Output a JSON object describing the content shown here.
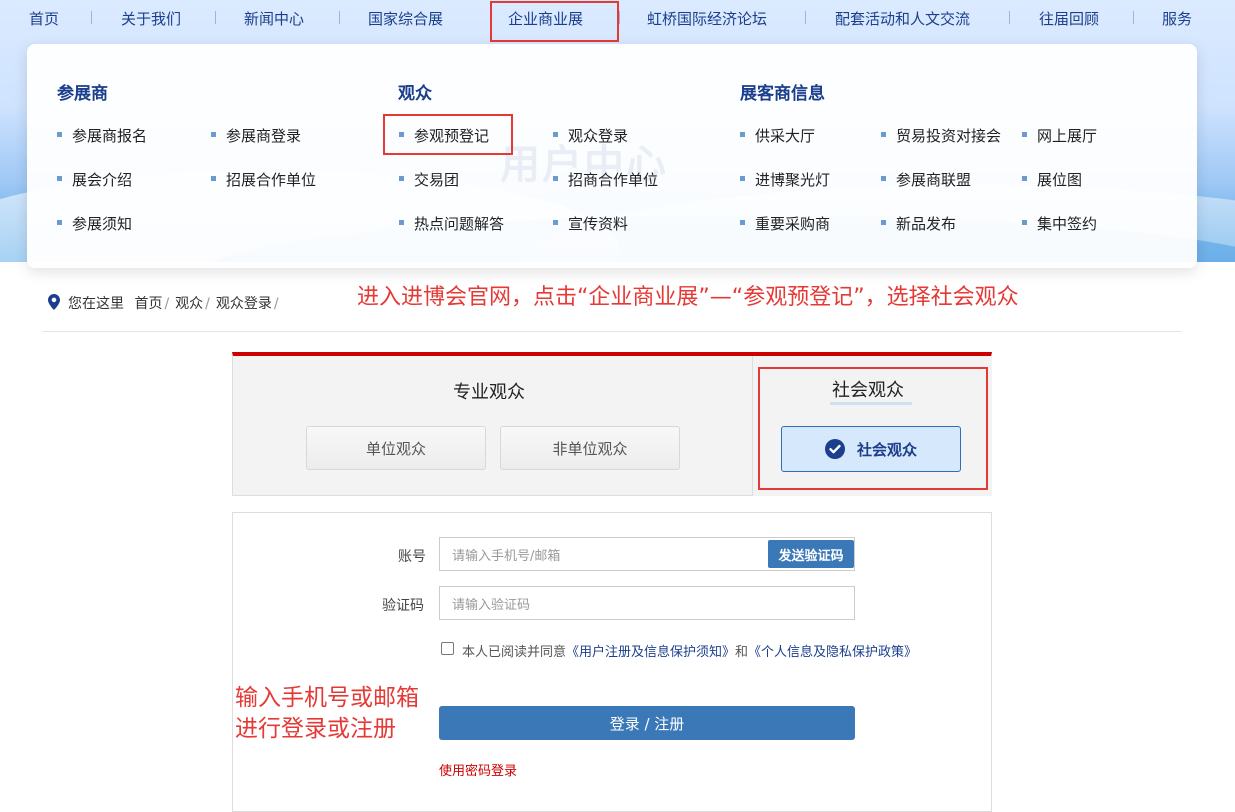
{
  "nav": {
    "items": [
      "首页",
      "关于我们",
      "新闻中心",
      "国家综合展",
      "企业商业展",
      "虹桥国际经济论坛",
      "配套活动和人文交流",
      "往届回顾",
      "服务"
    ],
    "active": "企业商业展"
  },
  "dropdown": {
    "watermark": "用户中心",
    "columns": [
      {
        "title": "参展商",
        "items": [
          "参展商报名",
          "参展商登录",
          "展会介绍",
          "招展合作单位",
          "参展须知"
        ]
      },
      {
        "title": "观众",
        "items": [
          "参观预登记",
          "观众登录",
          "交易团",
          "招商合作单位",
          "热点问题解答",
          "宣传资料"
        ]
      },
      {
        "title": "展客商信息",
        "items": [
          "供采大厅",
          "贸易投资对接会",
          "网上展厅",
          "进博聚光灯",
          "参展商联盟",
          "展位图",
          "重要采购商",
          "新品发布",
          "集中签约"
        ]
      }
    ]
  },
  "breadcrumb": {
    "prefix": "您在这里",
    "items": [
      "首页",
      "观众",
      "观众登录"
    ]
  },
  "annotations": {
    "top": "进入进博会官网，点击“企业商业展”—“参观预登记”，选择社会观众",
    "side_line1": "输入手机号或邮箱",
    "side_line2": "进行登录或注册"
  },
  "audience": {
    "professional_title": "专业观众",
    "unit_button": "单位观众",
    "non_unit_button": "非单位观众",
    "social_title": "社会观众",
    "social_button": "社会观众"
  },
  "form": {
    "account_label": "账号",
    "account_placeholder": "请输入手机号/邮箱",
    "send_code_button": "发送验证码",
    "code_label": "验证码",
    "code_placeholder": "请输入验证码",
    "agree_text": "本人已阅读并同意",
    "agree_link1": "《用户注册及信息保护须知》",
    "agree_and": "和",
    "agree_link2": "《个人信息及隐私保护政策》",
    "login_button": "登录 / 注册",
    "password_login": "使用密码登录"
  },
  "colors": {
    "accent": "#cc0000",
    "primary": "#3a78b8",
    "nav_text": "#1b3f8c",
    "annotation": "#e53935"
  }
}
